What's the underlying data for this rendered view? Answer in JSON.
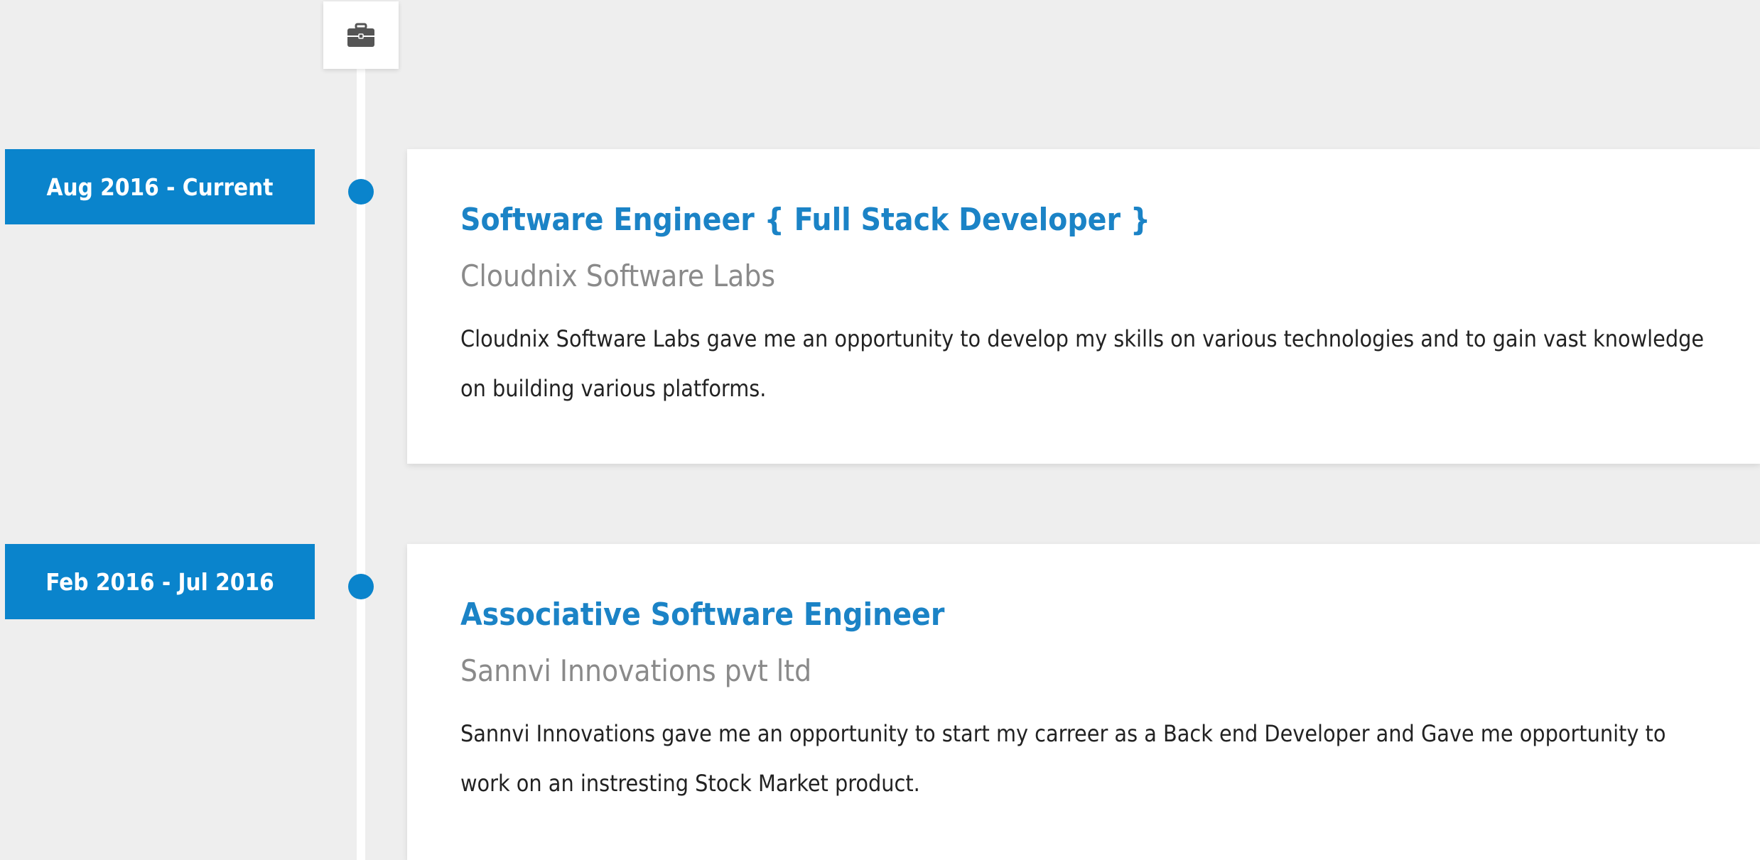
{
  "timeline": {
    "icon": "briefcase-icon",
    "accent_color": "#0a84cc",
    "entries": [
      {
        "date": "Aug 2016 - Current",
        "title": "Software Engineer { Full Stack Developer }",
        "company": "Cloudnix Software Labs",
        "description": "Cloudnix Software Labs gave me an opportunity to develop my skills on various technologies and to gain vast knowledge on building various platforms."
      },
      {
        "date": "Feb 2016 - Jul 2016",
        "title": "Associative Software Engineer",
        "company": "Sannvi Innovations pvt ltd",
        "description": "Sannvi Innovations gave me an opportunity to start my carreer as a Back end Developer and Gave me opportunity to work on an instresting Stock Market product."
      }
    ]
  }
}
